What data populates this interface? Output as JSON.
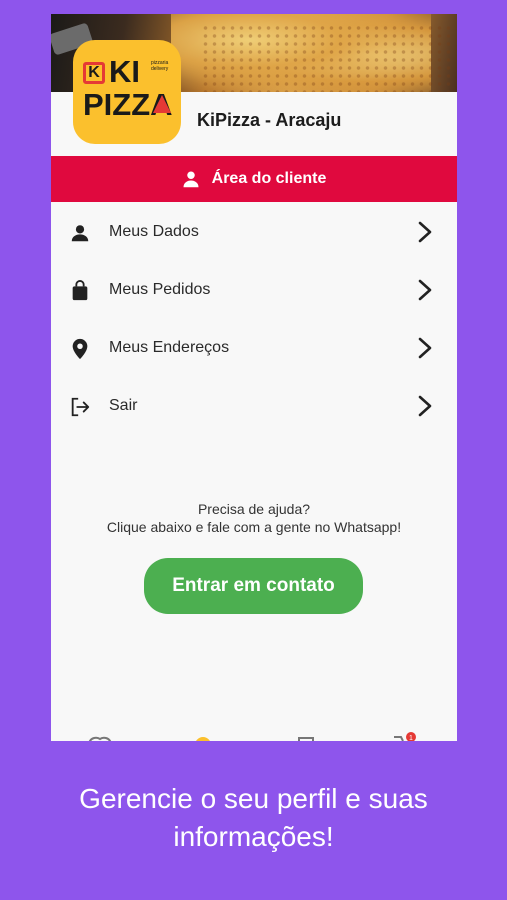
{
  "header": {
    "logo_text_top": "KI",
    "logo_text_bottom": "PIZZA",
    "logo_tagline": "pizzaria delivery",
    "store_name": "KiPizza - Aracaju"
  },
  "client_area": {
    "title": "Área do cliente",
    "icon": "person-icon"
  },
  "menu": {
    "items": [
      {
        "label": "Meus Dados",
        "icon": "person-icon"
      },
      {
        "label": "Meus Pedidos",
        "icon": "shopping-bag-icon"
      },
      {
        "label": "Meus Endereços",
        "icon": "location-pin-icon"
      },
      {
        "label": "Sair",
        "icon": "logout-icon"
      }
    ]
  },
  "help": {
    "line1": "Precisa de ajuda?",
    "line2": "Clique abaixo e fale com a gente no Whatsapp!",
    "button_label": "Entrar em contato"
  },
  "bottom_nav": {
    "cart_badge": "1"
  },
  "caption": {
    "line1": "Gerencie o seu perfil e suas",
    "line2": "informações!"
  },
  "colors": {
    "background": "#8e55ec",
    "accent_red": "#e0093e",
    "contact_green": "#4caf50",
    "logo_yellow": "#fbc02d"
  }
}
